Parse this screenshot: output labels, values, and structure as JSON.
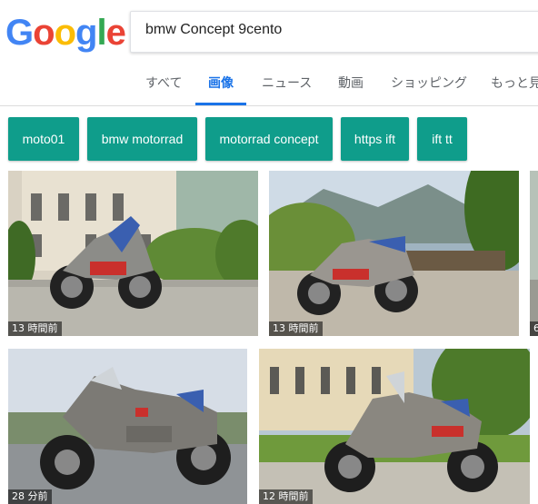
{
  "logo": {
    "text": "Google",
    "letters": [
      "G",
      "o",
      "o",
      "g",
      "l",
      "e"
    ],
    "colors": [
      "#4285F4",
      "#EA4335",
      "#FBBC05",
      "#4285F4",
      "#34A853",
      "#EA4335"
    ]
  },
  "search": {
    "query": "bmw Concept 9cento"
  },
  "tabs": [
    {
      "label": "すべて",
      "active": false
    },
    {
      "label": "画像",
      "active": true
    },
    {
      "label": "ニュース",
      "active": false
    },
    {
      "label": "動画",
      "active": false
    },
    {
      "label": "ショッピング",
      "active": false
    },
    {
      "label": "もっと見",
      "active": false
    }
  ],
  "chips": [
    {
      "label": "moto01"
    },
    {
      "label": "bmw motorrad"
    },
    {
      "label": "motorrad concept"
    },
    {
      "label": "https ift"
    },
    {
      "label": "ift tt"
    }
  ],
  "accent_color": "#1a73e8",
  "chip_color": "#0f9d8b",
  "results": [
    {
      "time": "13 時間前"
    },
    {
      "time": "13 時間前"
    },
    {
      "time": "6"
    },
    {
      "time": "28 分前"
    },
    {
      "time": "12 時間前"
    }
  ]
}
